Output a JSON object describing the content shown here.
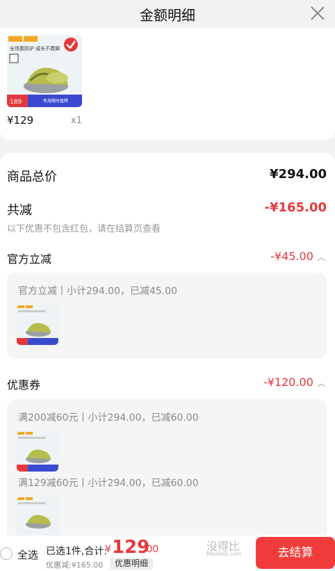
{
  "header": {
    "title": "金额明细"
  },
  "product": {
    "price": "¥129",
    "qty": "x1",
    "thumb_badge": "189",
    "thumb_caption": "全场靠防护 成长不费脚",
    "thumb_banner": "免海限时直降"
  },
  "summary": {
    "total_label": "商品总价",
    "total_value": "¥294.00",
    "reduce_label": "共减",
    "reduce_value": "-¥165.00",
    "reduce_note": "以下优惠不包含红包，请在结算页查看"
  },
  "official": {
    "label": "官方立减",
    "value": "-¥45.00",
    "detail": "官方立减丨小计294.00，已减45.00"
  },
  "coupon": {
    "label": "优惠券",
    "value": "-¥120.00",
    "detail_1": "满200减60元丨小计294.00，已减60.00",
    "detail_2": "满129减60元丨小计294.00，已减60.00"
  },
  "bottom": {
    "select_all": "全选",
    "selected": "已选1件,合计:",
    "currency": "¥",
    "amount_int": "129",
    "amount_dec": ".00",
    "discount": "优惠减:¥165.00",
    "detail_button": "优惠明细",
    "checkout_button": "去结算",
    "watermark": "没得比",
    "watermark_sub": "Meidebi.com"
  },
  "colors": {
    "accent_red": "#e4393c",
    "checkout_red": "#f23c3c"
  }
}
